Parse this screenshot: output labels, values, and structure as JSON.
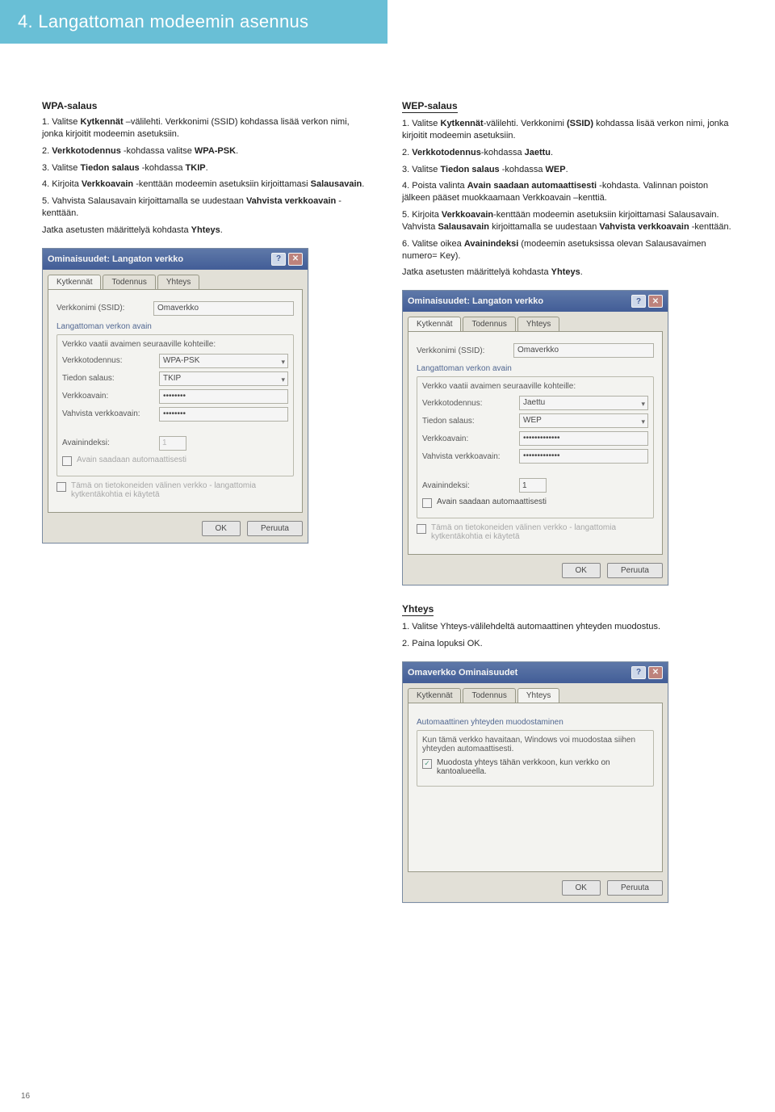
{
  "banner": {
    "title": "4. Langattoman modeemin asennus"
  },
  "pagenum": "16",
  "wpa": {
    "title": "WPA-salaus",
    "s1a": "1. Valitse ",
    "s1b": "Kytkennät",
    "s1c": " –välilehti. Verkkonimi (SSID) kohdassa lisää verkon nimi, jonka kirjoitit modeemin asetuksiin.",
    "s2a": "2. ",
    "s2b": "Verkkotodennus",
    "s2c": " -kohdassa valitse ",
    "s2d": "WPA-PSK",
    "s2e": ".",
    "s3a": "3. Valitse ",
    "s3b": "Tiedon salaus",
    "s3c": " -kohdassa ",
    "s3d": "TKIP",
    "s3e": ".",
    "s4a": "4. Kirjoita ",
    "s4b": "Verkkoavain",
    "s4c": " -kenttään modeemin asetuksiin kirjoittamasi ",
    "s4d": "Salausavain",
    "s4e": ".",
    "s5a": "5. Vahvista Salausavain kirjoittamalla se uudestaan ",
    "s5b": "Vahvista verkkoavain",
    "s5c": " -kenttään.",
    "s6a": "Jatka asetusten määrittelyä kohdasta ",
    "s6b": "Yhteys",
    "s6c": "."
  },
  "wep": {
    "title": "WEP-salaus",
    "s1a": "1. Valitse ",
    "s1b": "Kytkennät",
    "s1c": "-välilehti. Verkkonimi ",
    "s1d": "(SSID)",
    "s1e": " kohdassa lisää verkon nimi, jonka kirjoitit modeemin asetuksiin.",
    "s2a": "2. ",
    "s2b": "Verkkotodennus",
    "s2c": "-kohdassa ",
    "s2d": "Jaettu",
    "s2e": ".",
    "s3a": "3. Valitse ",
    "s3b": "Tiedon salaus",
    "s3c": " -kohdassa ",
    "s3d": "WEP",
    "s3e": ".",
    "s4a": "4. Poista valinta ",
    "s4b": "Avain saadaan automaattisesti",
    "s4c": " -kohdasta. Valinnan poiston jälkeen pääset muokkaamaan Verkkoavain –kenttiä.",
    "s5a": "5. Kirjoita ",
    "s5b": "Verkkoavain",
    "s5c": "-kenttään modeemin asetuksiin kirjoittamasi Salausavain. Vahvista ",
    "s5d": "Salausavain",
    "s5e": " kirjoittamalla se uudestaan ",
    "s5f": "Vahvista verkkoavain",
    "s5g": " -kenttään.",
    "s6a": "6. Valitse oikea ",
    "s6b": "Avainindeksi",
    "s6c": " (modeemin asetuksissa olevan Salausavaimen numero= Key).",
    "s7a": "Jatka asetusten määrittelyä kohdasta ",
    "s7b": "Yhteys",
    "s7c": "."
  },
  "yhteys": {
    "title": "Yhteys",
    "s1": "1. Valitse Yhteys-välilehdeltä automaattinen yhteyden muodostus.",
    "s2": "2. Paina lopuksi OK."
  },
  "dlg_wpa": {
    "title": "Ominaisuudet: Langaton verkko",
    "tabs": {
      "t1": "Kytkennät",
      "t2": "Todennus",
      "t3": "Yhteys"
    },
    "ssid_label": "Verkkonimi (SSID):",
    "ssid_val": "Omaverkko",
    "grp": "Langattoman verkon avain",
    "hint": "Verkko vaatii avaimen seuraaville kohteille:",
    "auth_label": "Verkkotodennus:",
    "auth_val": "WPA-PSK",
    "enc_label": "Tiedon salaus:",
    "enc_val": "TKIP",
    "key_label": "Verkkoavain:",
    "key_val": "••••••••",
    "key2_label": "Vahvista verkkoavain:",
    "key2_val": "••••••••",
    "idx_label": "Avainindeksi:",
    "idx_val": "1",
    "chk_auto": "Avain saadaan automaattisesti",
    "chk_adhoc": "Tämä on tietokoneiden välinen verkko - langattomia kytkentäkohtia ei käytetä",
    "ok": "OK",
    "cancel": "Peruuta"
  },
  "dlg_wep": {
    "title": "Ominaisuudet: Langaton verkko",
    "tabs": {
      "t1": "Kytkennät",
      "t2": "Todennus",
      "t3": "Yhteys"
    },
    "ssid_label": "Verkkonimi (SSID):",
    "ssid_val": "Omaverkko",
    "grp": "Langattoman verkon avain",
    "hint": "Verkko vaatii avaimen seuraaville kohteille:",
    "auth_label": "Verkkotodennus:",
    "auth_val": "Jaettu",
    "enc_label": "Tiedon salaus:",
    "enc_val": "WEP",
    "key_label": "Verkkoavain:",
    "key_val": "•••••••••••••",
    "key2_label": "Vahvista verkkoavain:",
    "key2_val": "•••••••••••••",
    "idx_label": "Avainindeksi:",
    "idx_val": "1",
    "chk_auto": "Avain saadaan automaattisesti",
    "chk_adhoc": "Tämä on tietokoneiden välinen verkko - langattomia kytkentäkohtia ei käytetä",
    "ok": "OK",
    "cancel": "Peruuta"
  },
  "dlg_yht": {
    "title": "Omaverkko Ominaisuudet",
    "tabs": {
      "t1": "Kytkennät",
      "t2": "Todennus",
      "t3": "Yhteys"
    },
    "grp": "Automaattinen yhteyden muodostaminen",
    "hint": "Kun tämä verkko havaitaan, Windows voi muodostaa siihen yhteyden automaattisesti.",
    "chk": "Muodosta yhteys tähän verkkoon, kun verkko on kantoalueella.",
    "ok": "OK",
    "cancel": "Peruuta"
  }
}
